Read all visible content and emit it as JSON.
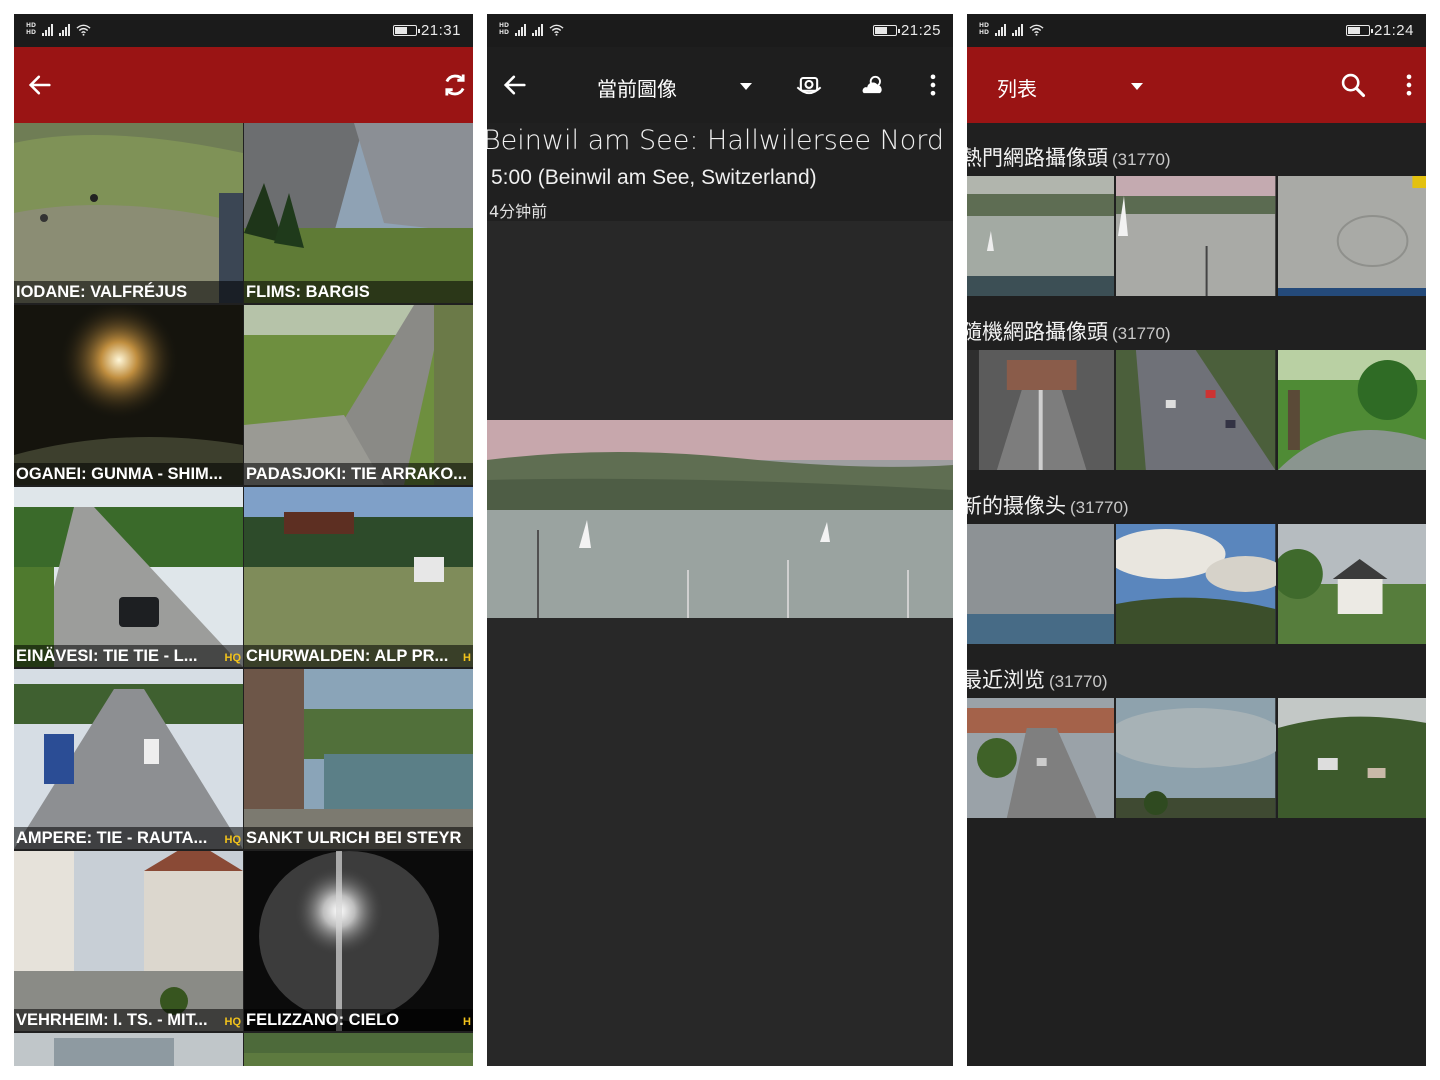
{
  "screen1": {
    "status": {
      "time": "21:31"
    },
    "appbar": {
      "back": "back-arrow-icon",
      "refresh": "refresh-icon"
    },
    "tiles": [
      {
        "caption": "IODANE: VALFRÉJUS",
        "hq": ""
      },
      {
        "caption": "FLIMS: BARGIS",
        "hq": ""
      },
      {
        "caption": "OGANEI: GUNMA - SHIM...",
        "hq": ""
      },
      {
        "caption": "PADASJOKI: TIE ARRAKO...",
        "hq": ""
      },
      {
        "caption": "EINÄVESI: TIE TIE - L...",
        "hq": "HQ"
      },
      {
        "caption": "CHURWALDEN: ALP PR...",
        "hq": "H"
      },
      {
        "caption": "AMPERE: TIE - RAUTA...",
        "hq": "HQ"
      },
      {
        "caption": "SANKT ULRICH BEI STEYR",
        "hq": ""
      },
      {
        "caption": "VEHRHEIM: I. TS. - MIT...",
        "hq": "HQ"
      },
      {
        "caption": "FELIZZANO: CIELO",
        "hq": "H"
      }
    ]
  },
  "screen2": {
    "status": {
      "time": "21:25"
    },
    "appbar": {
      "title": "當前圖像"
    },
    "camera": {
      "title": "Beinwil am See: Hallwilersee Nord",
      "subtitle": "5:00 (Beinwil am See, Switzerland)",
      "ago": "4分钟前"
    }
  },
  "screen3": {
    "status": {
      "time": "21:24"
    },
    "appbar": {
      "title": "列表"
    },
    "sections": [
      {
        "title": "熱門網路攝像頭",
        "count": "(31770)"
      },
      {
        "title": "隨機網路攝像頭",
        "count": "(31770)"
      },
      {
        "title": "新的摄像头",
        "count": "(31770)"
      },
      {
        "title": "最近浏览",
        "count": "(31770)"
      }
    ]
  },
  "colors": {
    "accent": "#9a1414",
    "background": "#202020",
    "hq": "#f1c21b"
  }
}
